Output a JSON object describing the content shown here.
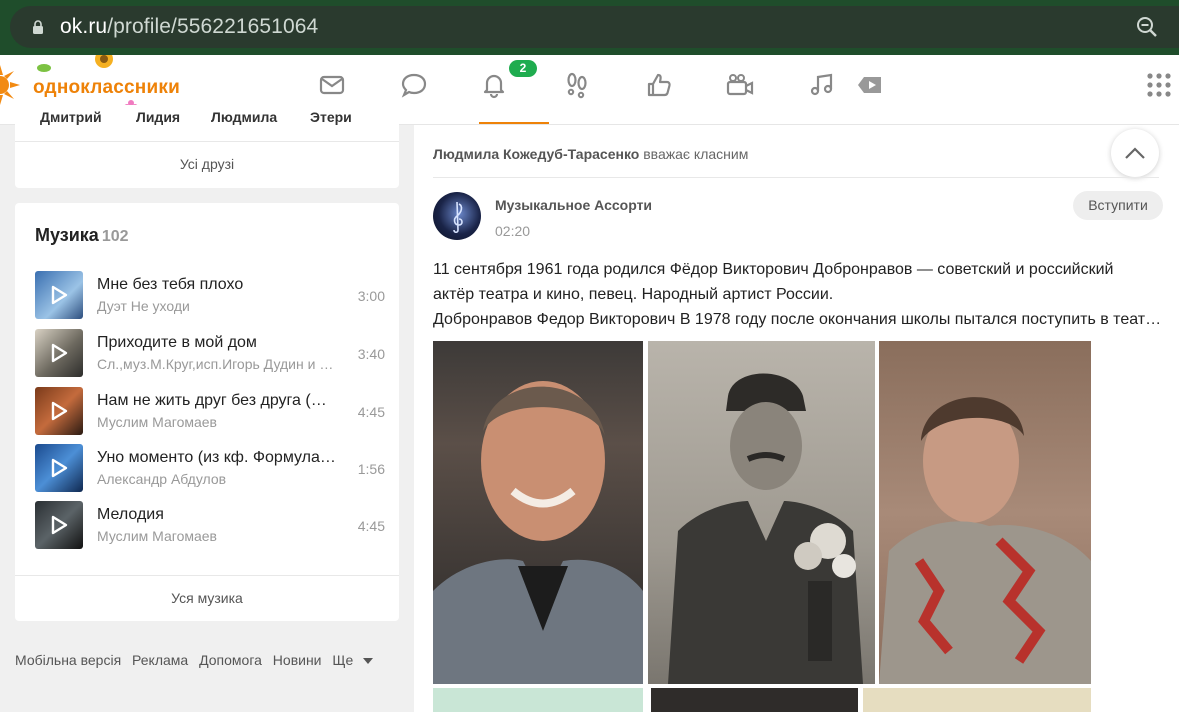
{
  "browser": {
    "url_host": "ok.ru",
    "url_path": "/profile/556221651064"
  },
  "header": {
    "logo_text": "одноклассники",
    "notification_count": "2",
    "nav_icons": [
      "messages-icon",
      "discussions-icon",
      "notifications-icon",
      "guests-icon",
      "marks-icon",
      "video-icon",
      "music-icon",
      "video-play-icon"
    ]
  },
  "friends": {
    "names": [
      "Дмитрий",
      "Лидия",
      "Людмила",
      "Этери"
    ],
    "all_friends_label": "Усі друзі"
  },
  "music": {
    "title": "Музика",
    "count": "102",
    "tracks": [
      {
        "title": "Мне без тебя плохо",
        "artist": "Дуэт Не уходи",
        "duration": "3:00"
      },
      {
        "title": "Приходите в мой дом",
        "artist": "Сл.,муз.М.Круг,исп.Игорь Дудин и Иван",
        "duration": "3:40"
      },
      {
        "title": "Нам не жить друг без друга (Осень)",
        "artist": "Муслим Магомаев",
        "duration": "4:45"
      },
      {
        "title": "Уно моменто (из кф. Формула любви)",
        "artist": "Александр Абдулов",
        "duration": "1:56"
      },
      {
        "title": "Мелодия",
        "artist": "Муслим Магомаев",
        "duration": "4:45"
      }
    ],
    "all_music_label": "Уся музика"
  },
  "footer": {
    "links": [
      "Мобільна версія",
      "Реклама",
      "Допомога",
      "Новини",
      "Ще"
    ]
  },
  "feed": {
    "liker_name": "Людмила Кожедуб-Тарасенко",
    "liker_action": "вважає класним",
    "group_name": "Музыкальное Ассорти",
    "post_time": "02:20",
    "join_label": "Вступити",
    "post_lines": [
      "11 сентября 1961 года родился Фёдор Викторович Добронравов — советский и российский",
      "актёр театра и кино, певец. Народный артист России.",
      "Добронравов Федор Викторович В 1978 году после окончания школы пытался поступить в театральное училище"
    ]
  },
  "colors": {
    "brand_orange": "#ee8208",
    "badge_green": "#1fac4f",
    "browser_green": "#1f4d2b"
  }
}
